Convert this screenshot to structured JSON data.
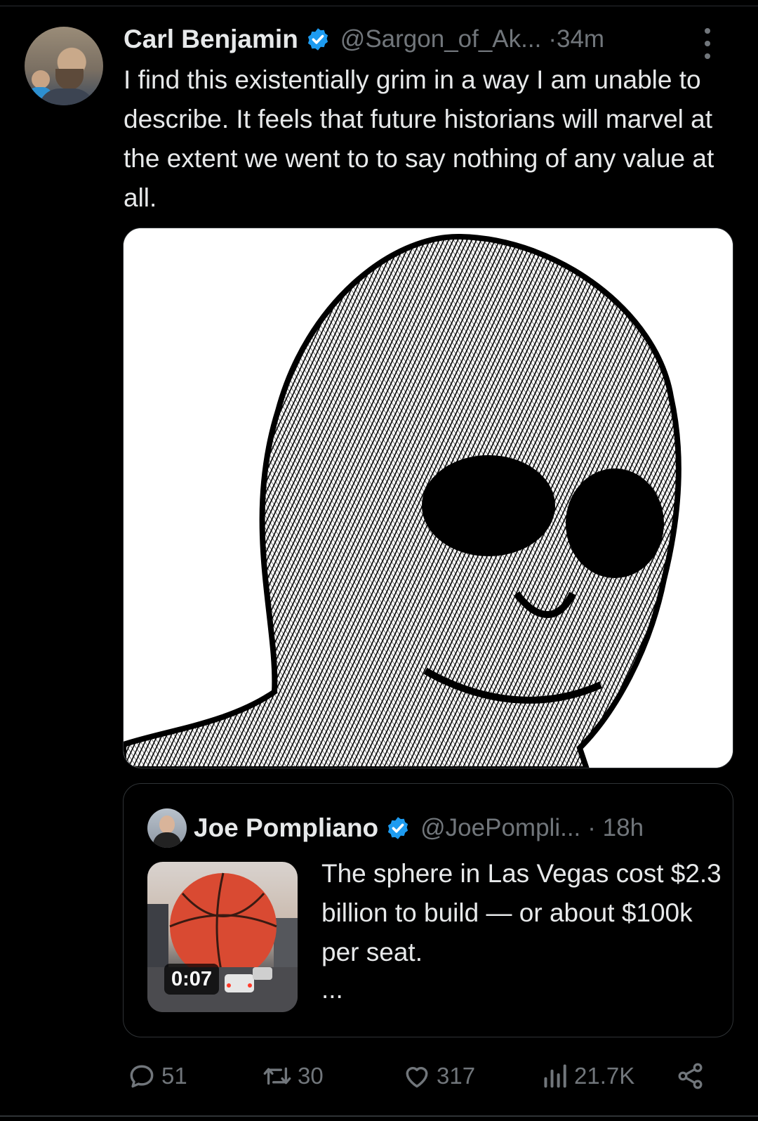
{
  "tweet": {
    "author_name": "Carl Benjamin",
    "handle": "@Sargon_of_Ak...",
    "time": "·34m",
    "text": "I find this existentially grim in a way I am unable to describe. It feels that future historians will marvel at the extent we went to to say nothing of any value at all."
  },
  "quoted_tweet": {
    "author_name": "Joe Pompliano",
    "handle": "@JoePompli...",
    "time": "· 18h",
    "text": "The sphere in Las Vegas cost $2.3 billion to build — or about $100k per seat.",
    "ellipsis": "...",
    "video_duration": "0:07"
  },
  "actions": {
    "replies": "51",
    "reposts": "30",
    "likes": "317",
    "views": "21.7K"
  },
  "colors": {
    "background": "#000000",
    "text": "#e7e9ea",
    "muted": "#71767b",
    "verified": "#1d9bf0",
    "border": "#2f3336"
  },
  "icons": {
    "verified": "verified-badge-icon",
    "more": "more-options-icon",
    "reply": "reply-icon",
    "repost": "repost-icon",
    "like": "heart-icon",
    "views": "views-chart-icon",
    "share": "share-icon"
  }
}
